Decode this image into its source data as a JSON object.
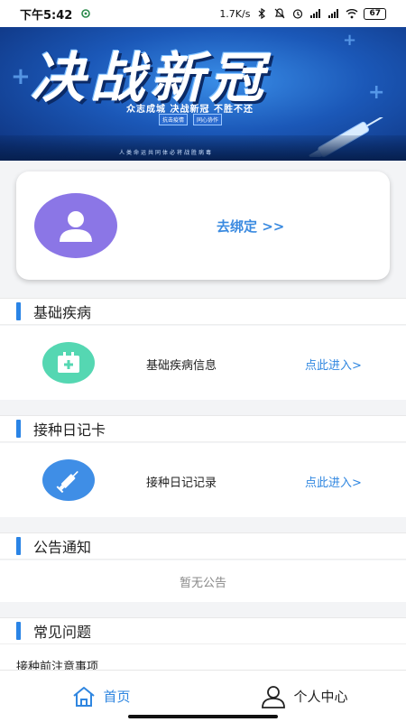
{
  "status_bar": {
    "time": "下午5:42",
    "net_speed": "1.7K/s",
    "battery": "67"
  },
  "banner": {
    "headline": "决战新冠",
    "subline": "众志成城 决战新冠 不胜不还",
    "tag_1": "抗击疫情",
    "tag_2": "同心协作",
    "tiny": "人类命运共同体必将战胜病毒"
  },
  "bind_card": {
    "bind_label": "去绑定 >>"
  },
  "sections": {
    "basic_disease": {
      "title": "基础疾病",
      "row_label": "基础疾病信息",
      "enter_label": "点此进入>"
    },
    "vaccination_diary": {
      "title": "接种日记卡",
      "row_label": "接种日记记录",
      "enter_label": "点此进入>"
    },
    "announcements": {
      "title": "公告通知",
      "empty_text": "暂无公告"
    },
    "faq": {
      "title": "常见问题",
      "first_item": "接种前注意事项"
    }
  },
  "tab_bar": {
    "home_label": "首页",
    "profile_label": "个人中心",
    "active_color": "#2f86e0"
  },
  "colors": {
    "accent": "#2a84e6",
    "avatar_bg": "#8b76e6",
    "disease_icon_bg": "#55d7b2",
    "vaccine_icon_bg": "#3f8ee6"
  }
}
